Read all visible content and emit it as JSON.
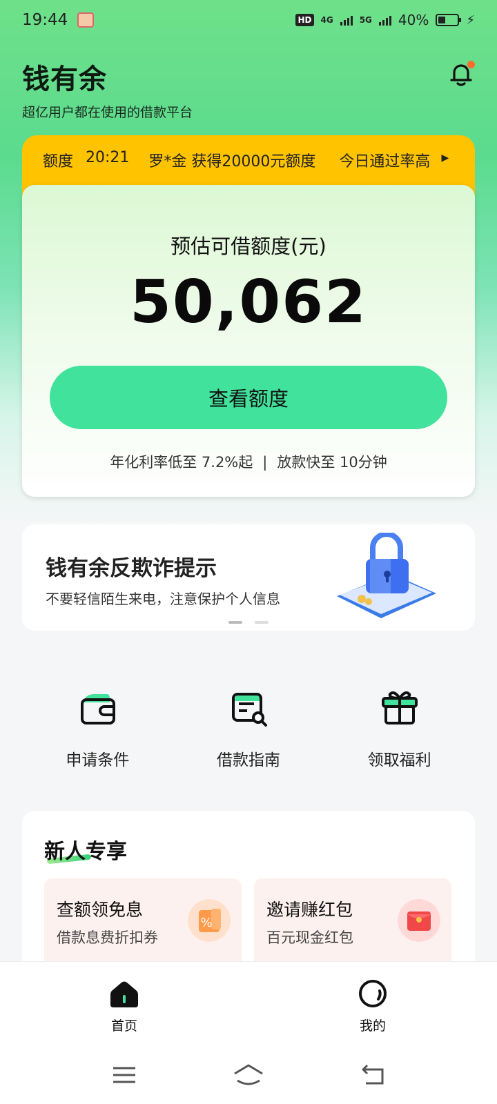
{
  "status_bar": {
    "time": "19:44",
    "network_1": "4G",
    "network_2": "5G",
    "hd_label": "HD",
    "battery": "40%",
    "battery_level": 0.4
  },
  "header": {
    "title": "钱有余",
    "subtitle": "超亿用户都在使用的借款平台"
  },
  "ticker": {
    "label": "额度",
    "time": "20:21",
    "message": "罗*金 获得20000元额度",
    "hint": "今日通过率高"
  },
  "quota_card": {
    "label": "预估可借额度(元)",
    "amount": "50,062",
    "button_label": "查看额度",
    "rate_text": "年化利率低至 7.2%起",
    "separator": "|",
    "speed_text": "放款快至 10分钟"
  },
  "banner": {
    "title": "钱有余反欺诈提示",
    "description": "不要轻信陌生来电，注意保护个人信息",
    "slide_count": 2,
    "active_slide": 1
  },
  "shortcuts": [
    {
      "label": "申请条件",
      "icon": "wallet-icon"
    },
    {
      "label": "借款指南",
      "icon": "guide-search-icon"
    },
    {
      "label": "领取福利",
      "icon": "gift-icon"
    }
  ],
  "newcomer": {
    "title": "新人专享",
    "perks": [
      {
        "title": "查额领免息",
        "desc": "借款息费折扣券",
        "icon": "discount-coupon-icon"
      },
      {
        "title": "邀请赚红包",
        "desc": "百元现金红包",
        "icon": "red-envelope-icon"
      }
    ]
  },
  "tabbar": {
    "home": "首页",
    "mine": "我的"
  },
  "colors": {
    "accent": "#41e29c",
    "ticker_bg": "#ffc300",
    "notification_dot": "#ff6b2c"
  }
}
